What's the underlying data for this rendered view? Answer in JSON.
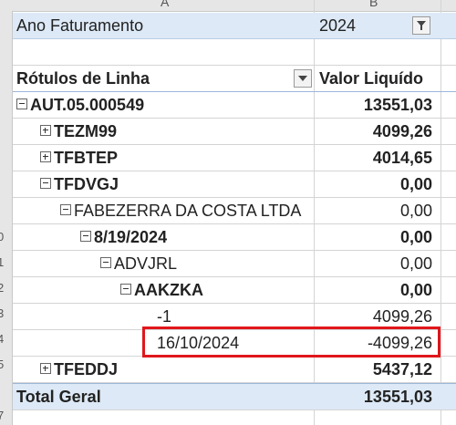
{
  "columns": {
    "a": "A",
    "b": "B"
  },
  "row_numbers": [
    "0",
    "1",
    "2",
    "3",
    "4",
    "5",
    "7"
  ],
  "filter": {
    "label": "Ano Faturamento",
    "value": "2024"
  },
  "header": {
    "row_labels": "Rótulos de Linha",
    "value_label": "Valor Liquído"
  },
  "rows": [
    {
      "label": "AUT.05.000549",
      "value": "13551,03"
    },
    {
      "label": "TEZM99",
      "value": "4099,26"
    },
    {
      "label": "TFBTEP",
      "value": "4014,65"
    },
    {
      "label": "TFDVGJ",
      "value": "0,00"
    },
    {
      "label": "FABEZERRA DA COSTA LTDA",
      "value": "0,00"
    },
    {
      "label": "8/19/2024",
      "value": "0,00"
    },
    {
      "label": "ADVJRL",
      "value": "0,00"
    },
    {
      "label": "AAKZKA",
      "value": "0,00"
    },
    {
      "label": "-1",
      "value": "4099,26"
    },
    {
      "label": "16/10/2024",
      "value": "-4099,26"
    },
    {
      "label": "TFEDDJ",
      "value": "5437,12"
    }
  ],
  "total": {
    "label": "Total Geral",
    "value": "13551,03"
  },
  "colors": {
    "filter_band": "#dde9f6",
    "highlight_border": "#e0161b"
  }
}
